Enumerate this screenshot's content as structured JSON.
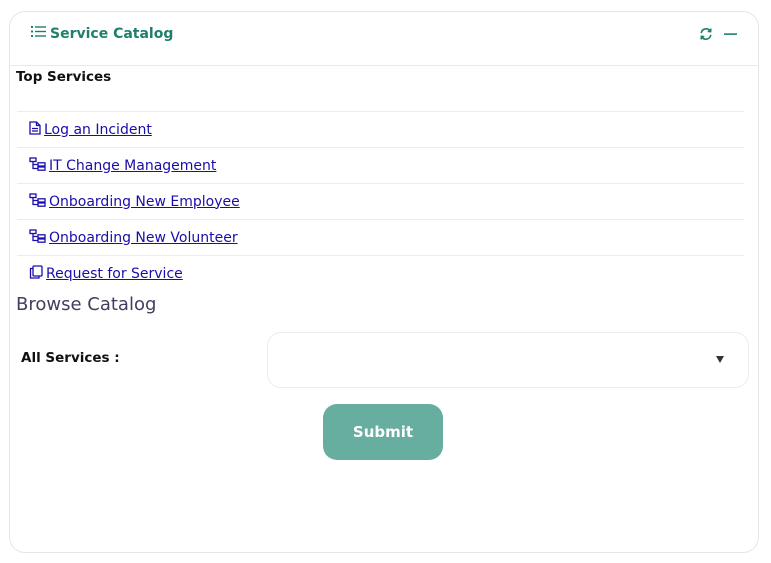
{
  "header": {
    "title": "Service Catalog",
    "title_icon": "list-icon",
    "tools": [
      "refresh-icon",
      "minimize-icon"
    ]
  },
  "top_services": {
    "title": "Top Services",
    "items": [
      {
        "label": "Log an Incident",
        "icon": "document-icon"
      },
      {
        "label": "IT Change Management",
        "icon": "workflow-icon"
      },
      {
        "label": "Onboarding New Employee",
        "icon": "workflow-icon"
      },
      {
        "label": "Onboarding New Volunteer",
        "icon": "workflow-icon"
      },
      {
        "label": "Request for Service",
        "icon": "copy-icon"
      }
    ]
  },
  "browse": {
    "title": "Browse Catalog",
    "all_services_label": "All Services :",
    "selected_value": "",
    "submit_label": "Submit"
  },
  "colors": {
    "accent": "#1f7f6d",
    "link": "#1a0dab",
    "submit_bg": "#67ada0"
  }
}
